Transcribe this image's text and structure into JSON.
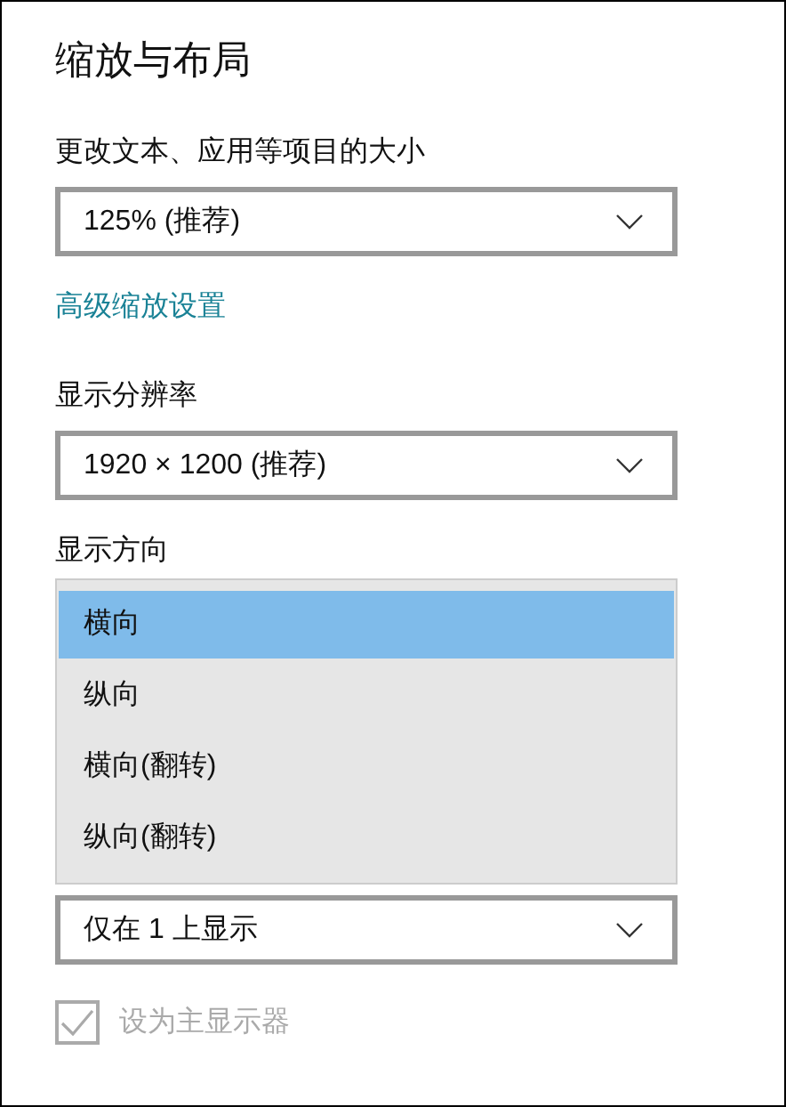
{
  "title": "缩放与布局",
  "scale": {
    "label": "更改文本、应用等项目的大小",
    "value": "125% (推荐)"
  },
  "advanced_link": "高级缩放设置",
  "resolution": {
    "label": "显示分辨率",
    "value": "1920 × 1200 (推荐)"
  },
  "orientation": {
    "label": "显示方向",
    "expanded": true,
    "options": [
      {
        "label": "横向",
        "selected": true
      },
      {
        "label": "纵向",
        "selected": false
      },
      {
        "label": "横向(翻转)",
        "selected": false
      },
      {
        "label": "纵向(翻转)",
        "selected": false
      }
    ]
  },
  "multiple_displays": {
    "value": "仅在 1 上显示"
  },
  "main_display": {
    "label": "设为主显示器",
    "checked": true,
    "disabled": true
  }
}
